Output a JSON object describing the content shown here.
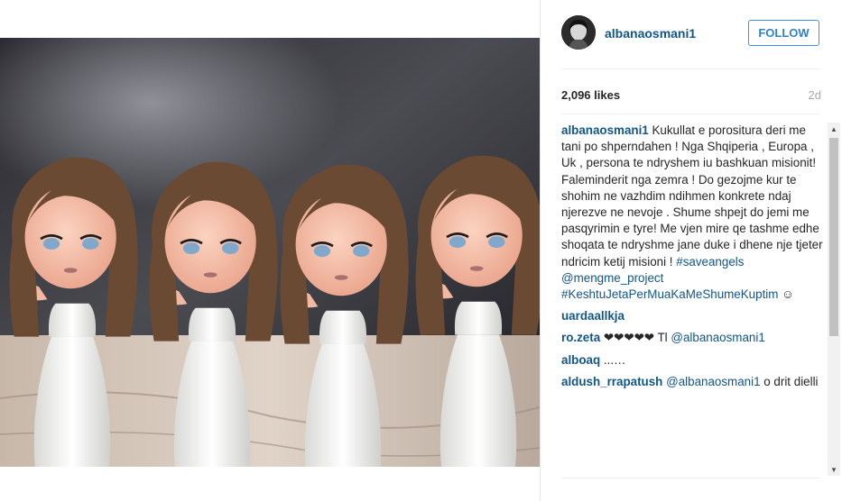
{
  "post": {
    "username": "albanaosmani1",
    "follow_label": "FOLLOW",
    "likes": "2,096 likes",
    "time": "2d"
  },
  "caption": {
    "user": "albanaosmani1",
    "text": " Kukullat e porositura deri me tani po shperndahen ! Nga Shqiperia , Europa , Uk , persona te ndryshem iu bashkuan misionit! Faleminderit nga zemra ! Do gezojme kur te shohim ne vazhdim ndihmen konkrete ndaj njerezve ne nevoje . Shume shpejt do jemi me pasqyrimin e tyre! Me vjen mire qe tashme edhe shoqata te ndryshme jane duke i dhene nje tjeter ndricim ketij misioni ! ",
    "hashtag1": "#saveangels",
    "mention1": "@mengme_project",
    "hashtag2": "#KeshtuJetaPerMuaKaMeShumeKuptim",
    "emoji": "☺"
  },
  "comments": [
    {
      "user": "uardaallkja",
      "text": "",
      "mention": "",
      "text2": ""
    },
    {
      "user": "ro.zeta",
      "text": "❤❤❤❤❤ Tl ",
      "mention": "@albanaosmani1",
      "text2": ""
    },
    {
      "user": "alboaq",
      "text": "...…",
      "mention": "",
      "text2": ""
    },
    {
      "user": "aldush_rrapatush",
      "text": "",
      "mention": "@albanaosmani1",
      "text2": " o drit dielli"
    }
  ],
  "colors": {
    "link": "#125688",
    "follow": "#2f81cc",
    "muted": "#a5a7aa"
  },
  "icons": {
    "scroll_up": "triangle-up",
    "scroll_down": "triangle-down"
  }
}
